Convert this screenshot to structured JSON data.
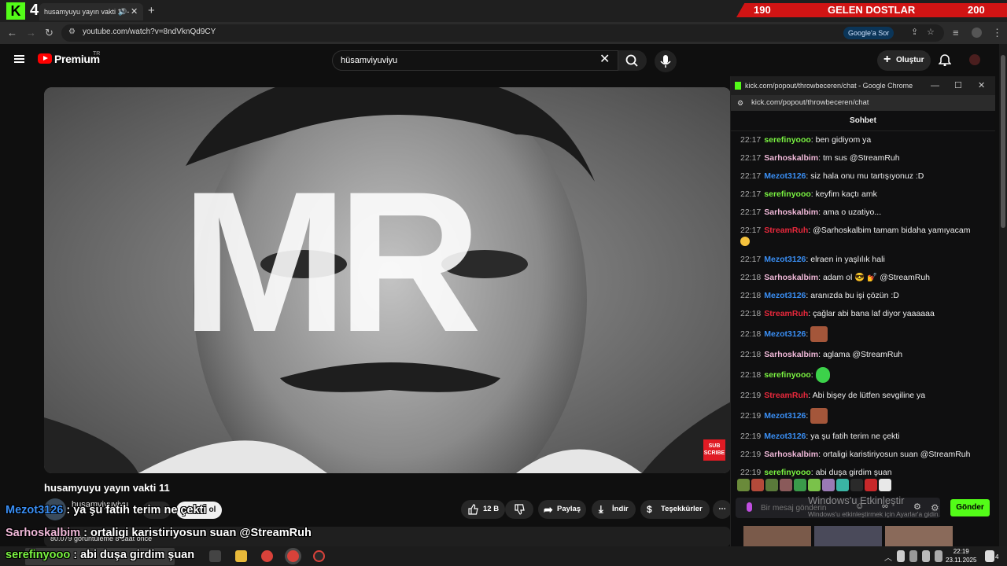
{
  "browser": {
    "tab_count": "4",
    "tab_title": "husamyuyu yayın vakti 11 -",
    "url": "youtube.com/watch?v=8ndVknQd9CY",
    "google_sor": "Google'a Sor"
  },
  "banner": {
    "left_value": "190",
    "label": "GELEN DOSTLAR",
    "right_value": "200"
  },
  "youtube": {
    "brand": "Premium",
    "brand_region": "TR",
    "search_value": "hüsamviyuviyu",
    "create_label": "Oluştur",
    "video_overlay_text": "MR",
    "sub_badge": "SUB SCRIBE",
    "video_title": "husamyuyu yayın vakti 11",
    "channel_name": "husamviyuviyu",
    "subscribe_label": "Abone ol",
    "like_count": "12 B",
    "share_label": "Paylaş",
    "download_label": "İndir",
    "thanks_label": "Teşekkürler",
    "views_text": "80.079 görüntüleme  8 saat önce"
  },
  "chat_window": {
    "window_title": "kick.com/popout/throwbeceren/chat - Google Chrome",
    "url": "kick.com/popout/throwbeceren/chat",
    "header": "Sohbet",
    "messages": [
      {
        "time": "22:17",
        "user": "serefinyooo",
        "color": "#7bf542",
        "text": "ben gidiyom ya"
      },
      {
        "time": "22:17",
        "user": "Sarhoskalbim",
        "color": "#f0b8d8",
        "text": "tm sus @StreamRuh"
      },
      {
        "time": "22:17",
        "user": "Mezot3126",
        "color": "#3a8ff5",
        "text": "siz hala onu mu tartışıyonuz :D"
      },
      {
        "time": "22:17",
        "user": "serefinyooo",
        "color": "#7bf542",
        "text": "keyfim kaçtı amk"
      },
      {
        "time": "22:17",
        "user": "Sarhoskalbim",
        "color": "#f0b8d8",
        "text": "ama o uzatiyo..."
      },
      {
        "time": "22:17",
        "user": "StreamRuh",
        "color": "#e8283c",
        "text": "@Sarhoskalbim tamam bidaha yamıyacam"
      },
      {
        "time": "22:17",
        "user": "Mezot3126",
        "color": "#3a8ff5",
        "text": "elraen in yaşlılık hali"
      },
      {
        "time": "22:18",
        "user": "Sarhoskalbim",
        "color": "#f0b8d8",
        "text": "adam ol 😎 💅 @StreamRuh"
      },
      {
        "time": "22:18",
        "user": "Mezot3126",
        "color": "#3a8ff5",
        "text": "aranızda bu işi çözün :D"
      },
      {
        "time": "22:18",
        "user": "StreamRuh",
        "color": "#e8283c",
        "text": "çağlar abi bana laf diyor yaaaaaa"
      },
      {
        "time": "22:18",
        "user": "Mezot3126",
        "color": "#3a8ff5",
        "text": ""
      },
      {
        "time": "22:18",
        "user": "Sarhoskalbim",
        "color": "#f0b8d8",
        "text": "aglama @StreamRuh"
      },
      {
        "time": "22:18",
        "user": "serefinyooo",
        "color": "#7bf542",
        "text": ""
      },
      {
        "time": "22:19",
        "user": "StreamRuh",
        "color": "#e8283c",
        "text": "Abi bişey de lütfen sevgiline ya"
      },
      {
        "time": "22:19",
        "user": "Mezot3126",
        "color": "#3a8ff5",
        "text": ""
      },
      {
        "time": "22:19",
        "user": "Mezot3126",
        "color": "#3a8ff5",
        "text": "ya şu fatih terim ne çekti"
      },
      {
        "time": "22:19",
        "user": "Sarhoskalbim",
        "color": "#f0b8d8",
        "text": "ortaligi karistiriyosun suan @StreamRuh"
      },
      {
        "time": "22:19",
        "user": "serefinyooo",
        "color": "#7bf542",
        "text": "abi duşa girdim şuan"
      }
    ],
    "input_placeholder": "Bir mesaj gönderin",
    "send_label": "Gönder",
    "activate_windows": "Windows'u Etkinleştir",
    "activate_windows_sub": "Windows'u etkinleştirmek için Ayarlar'a gidin."
  },
  "overlay": [
    {
      "user": "Mezot3126",
      "color": "#3a8ff5",
      "text": "ya şu fatih terim ne çekti"
    },
    {
      "user": "Sarhoskalbim",
      "color": "#f0b8d8",
      "text": "ortaligi karistiriyosun suan @StreamRuh"
    },
    {
      "user": "serefinyooo",
      "color": "#7bf542",
      "text": "abi duşa girdim şuan"
    }
  ],
  "taskbar": {
    "time": "22:19",
    "date": "23.11.2025",
    "notification_count": "4"
  }
}
